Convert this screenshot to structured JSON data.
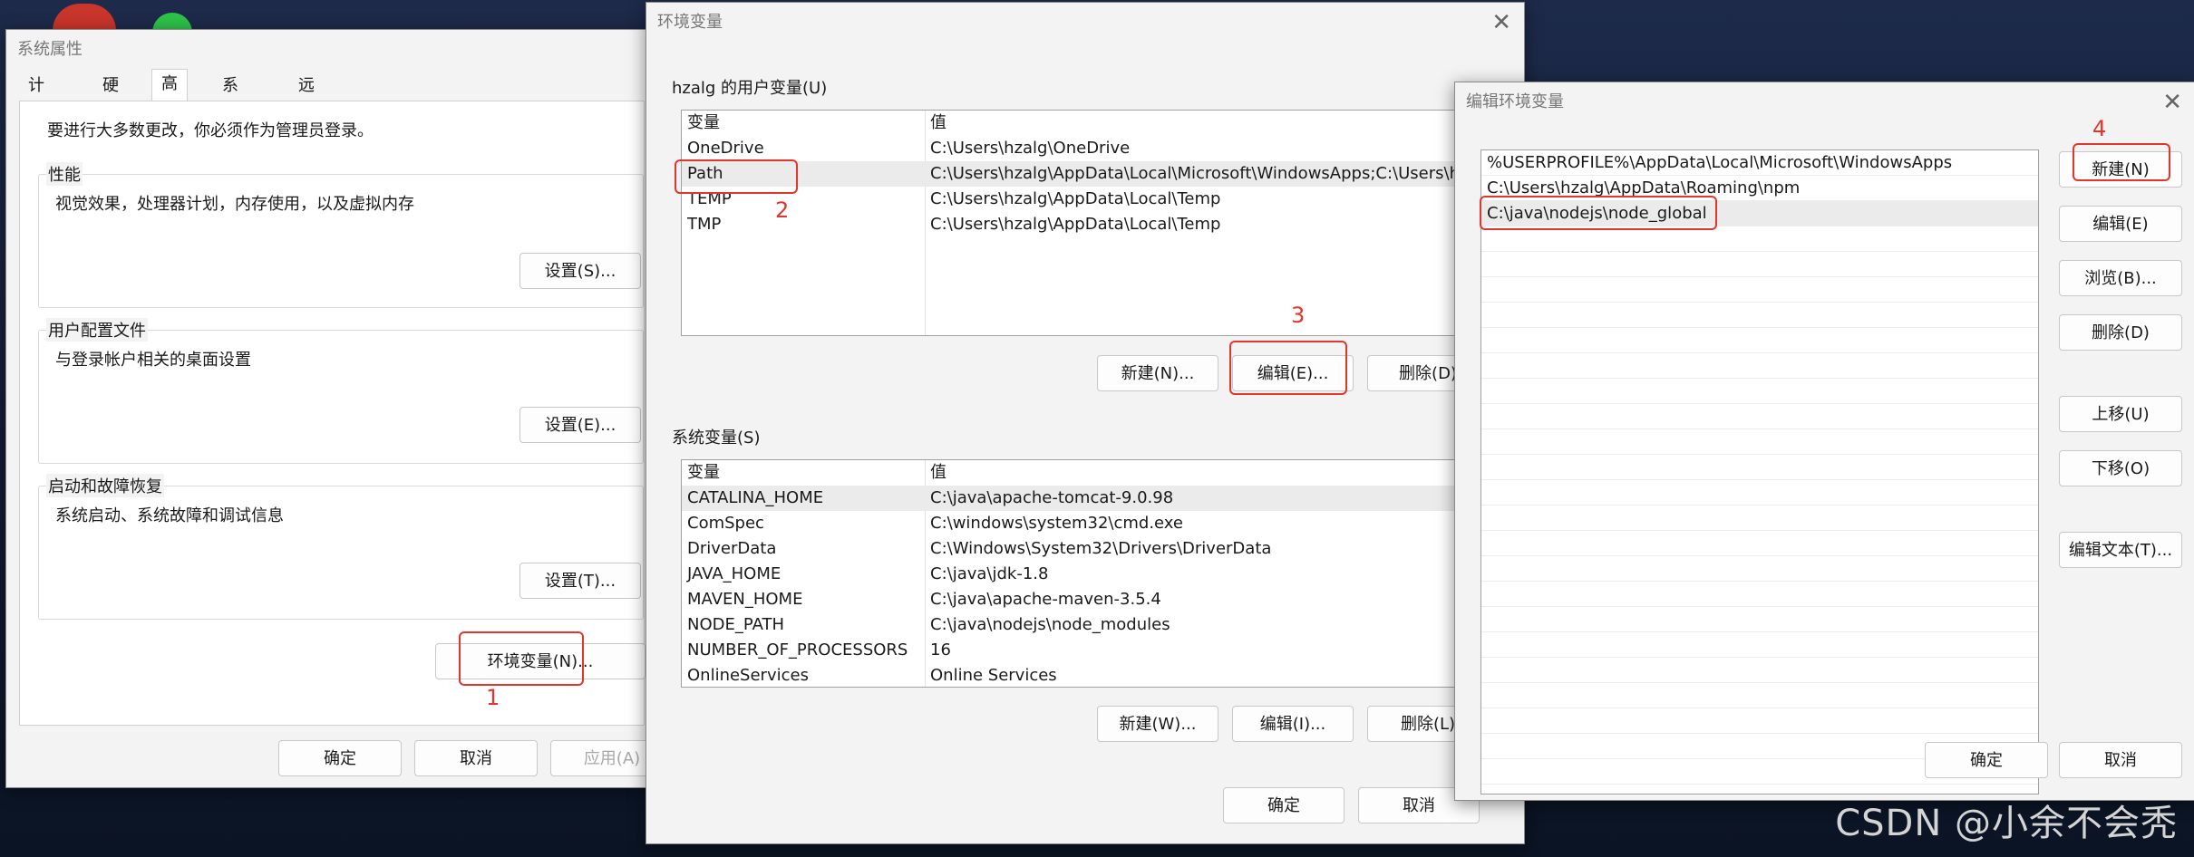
{
  "sys_props": {
    "title": "系统属性",
    "tabs": [
      "计算机名",
      "硬件",
      "高级",
      "系统保护",
      "远程"
    ],
    "admin_note": "要进行大多数更改，你必须作为管理员登录。",
    "performance": {
      "label": "性能",
      "desc": "视觉效果，处理器计划，内存使用，以及虚拟内存",
      "button": "设置(S)..."
    },
    "profile": {
      "label": "用户配置文件",
      "desc": "与登录帐户相关的桌面设置",
      "button": "设置(E)..."
    },
    "startup": {
      "label": "启动和故障恢复",
      "desc": "系统启动、系统故障和调试信息",
      "button": "设置(T)..."
    },
    "env_button": "环境变量(N)...",
    "ok": "确定",
    "cancel": "取消",
    "apply": "应用(A)"
  },
  "env_vars": {
    "title": "环境变量",
    "user_section": "hzalg 的用户变量(U)",
    "col_var": "变量",
    "col_val": "值",
    "user_rows": [
      {
        "name": "OneDrive",
        "value": "C:\\Users\\hzalg\\OneDrive"
      },
      {
        "name": "Path",
        "value": "C:\\Users\\hzalg\\AppData\\Local\\Microsoft\\WindowsApps;C:\\Users\\h..."
      },
      {
        "name": "TEMP",
        "value": "C:\\Users\\hzalg\\AppData\\Local\\Temp"
      },
      {
        "name": "TMP",
        "value": "C:\\Users\\hzalg\\AppData\\Local\\Temp"
      }
    ],
    "user_new": "新建(N)...",
    "user_edit": "编辑(E)...",
    "user_delete": "删除(D)",
    "sys_section": "系统变量(S)",
    "sys_rows": [
      {
        "name": "CATALINA_HOME",
        "value": "C:\\java\\apache-tomcat-9.0.98"
      },
      {
        "name": "ComSpec",
        "value": "C:\\windows\\system32\\cmd.exe"
      },
      {
        "name": "DriverData",
        "value": "C:\\Windows\\System32\\Drivers\\DriverData"
      },
      {
        "name": "JAVA_HOME",
        "value": "C:\\java\\jdk-1.8"
      },
      {
        "name": "MAVEN_HOME",
        "value": "C:\\java\\apache-maven-3.5.4"
      },
      {
        "name": "NODE_PATH",
        "value": "C:\\java\\nodejs\\node_modules"
      },
      {
        "name": "NUMBER_OF_PROCESSORS",
        "value": "16"
      },
      {
        "name": "OnlineServices",
        "value": "Online Services"
      }
    ],
    "sys_new": "新建(W)...",
    "sys_edit": "编辑(I)...",
    "sys_delete": "删除(L)",
    "ok": "确定",
    "cancel": "取消"
  },
  "edit_env": {
    "title": "编辑环境变量",
    "entries": [
      "%USERPROFILE%\\AppData\\Local\\Microsoft\\WindowsApps",
      "C:\\Users\\hzalg\\AppData\\Roaming\\npm",
      "C:\\java\\nodejs\\node_global"
    ],
    "new": "新建(N)",
    "edit": "编辑(E)",
    "browse": "浏览(B)...",
    "delete": "删除(D)",
    "move_up": "上移(U)",
    "move_down": "下移(O)",
    "edit_text": "编辑文本(T)...",
    "ok": "确定",
    "cancel": "取消"
  },
  "annotations": [
    "1",
    "2",
    "3",
    "4"
  ],
  "watermark": "CSDN @小余不会秃",
  "colors": {
    "annotation": "#e2352b",
    "selection": "#ebebeb",
    "dialog_bg": "#f3f3f3"
  }
}
